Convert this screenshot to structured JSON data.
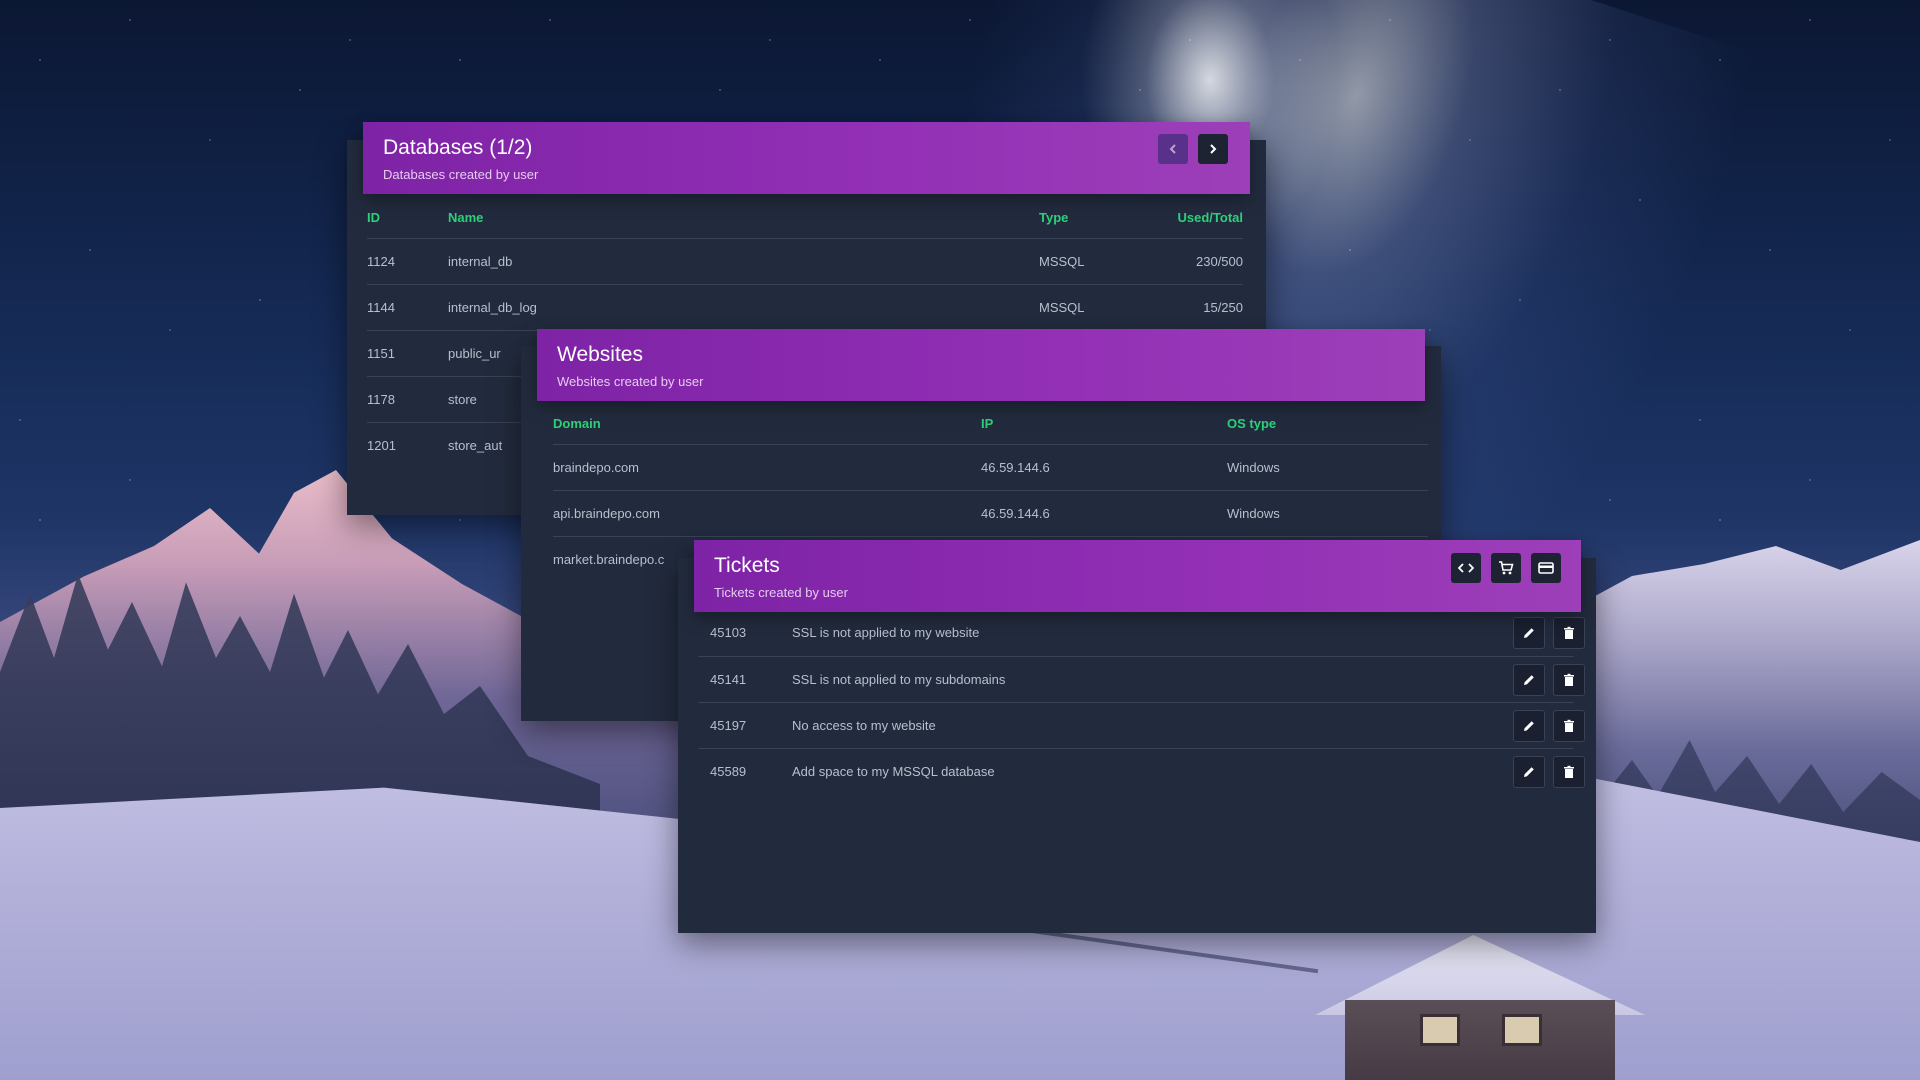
{
  "databases": {
    "title": "Databases (1/2)",
    "subtitle": "Databases created by user",
    "columns": {
      "id": "ID",
      "name": "Name",
      "type": "Type",
      "used": "Used/Total"
    },
    "rows": [
      {
        "id": "1124",
        "name": "internal_db",
        "type": "MSSQL",
        "used": "230/500"
      },
      {
        "id": "1144",
        "name": "internal_db_log",
        "type": "MSSQL",
        "used": "15/250"
      },
      {
        "id": "1151",
        "name": "public_ur",
        "type": "",
        "used": ""
      },
      {
        "id": "1178",
        "name": "store",
        "type": "",
        "used": ""
      },
      {
        "id": "1201",
        "name": "store_aut",
        "type": "",
        "used": ""
      }
    ],
    "prev_icon": "chevron-left-icon",
    "next_icon": "chevron-right-icon"
  },
  "websites": {
    "title": "Websites",
    "subtitle": "Websites created by user",
    "columns": {
      "domain": "Domain",
      "ip": "IP",
      "os": "OS type"
    },
    "rows": [
      {
        "domain": "braindepo.com",
        "ip": "46.59.144.6",
        "os": "Windows"
      },
      {
        "domain": "api.braindepo.com",
        "ip": "46.59.144.6",
        "os": "Windows"
      },
      {
        "domain": "market.braindepo.c",
        "ip": "",
        "os": ""
      }
    ]
  },
  "tickets": {
    "title": "Tickets",
    "subtitle": "Tickets created by user",
    "header_icons": [
      "code-icon",
      "cart-icon",
      "card-icon"
    ],
    "rows": [
      {
        "id": "45103",
        "subject": "SSL is not applied to my website"
      },
      {
        "id": "45141",
        "subject": "SSL is not applied to my subdomains"
      },
      {
        "id": "45197",
        "subject": "No access to my website"
      },
      {
        "id": "45589",
        "subject": "Add space to my MSSQL database"
      }
    ]
  },
  "colors": {
    "panel": "#222b3e",
    "header": "#8b2cb0",
    "column_header": "#2fd07a"
  }
}
